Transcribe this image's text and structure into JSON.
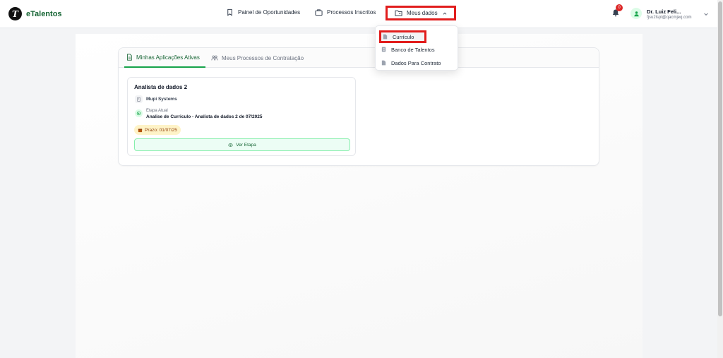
{
  "brand": {
    "name": "eTalentos",
    "logo_letter": "T"
  },
  "nav": {
    "items": [
      {
        "label": "Painel de Oportunidades",
        "icon": "bookmark-icon"
      },
      {
        "label": "Processos Inscritos",
        "icon": "briefcase-icon"
      },
      {
        "label": "Meus dados",
        "icon": "folder-user-icon",
        "expanded": true
      }
    ]
  },
  "notifications": {
    "count": "0"
  },
  "user": {
    "name": "Dr. Luiz Feli...",
    "email": "fjsu2lspl@qacmjeq.com"
  },
  "dropdown": {
    "items": [
      {
        "label": "Currículo",
        "icon": "document-icon"
      },
      {
        "label": "Banco de Talentos",
        "icon": "database-icon"
      },
      {
        "label": "Dados Para Contrato",
        "icon": "document-icon"
      }
    ]
  },
  "tabs": [
    {
      "label": "Minhas Aplicações Ativas",
      "active": true
    },
    {
      "label": "Meus Processos de Contratação",
      "active": false
    }
  ],
  "application": {
    "title": "Analista de dados 2",
    "company": "Mupi Systems",
    "stage_label": "Etapa Atual",
    "stage_value": "Analise de Curriculo - Analista de dados 2 de 07/2025",
    "deadline": "Prazo: 01/07/25",
    "action_label": "Ver Etapa"
  },
  "colors": {
    "accent": "#16a34a",
    "brand": "#166534",
    "highlight": "#e11d1d"
  }
}
